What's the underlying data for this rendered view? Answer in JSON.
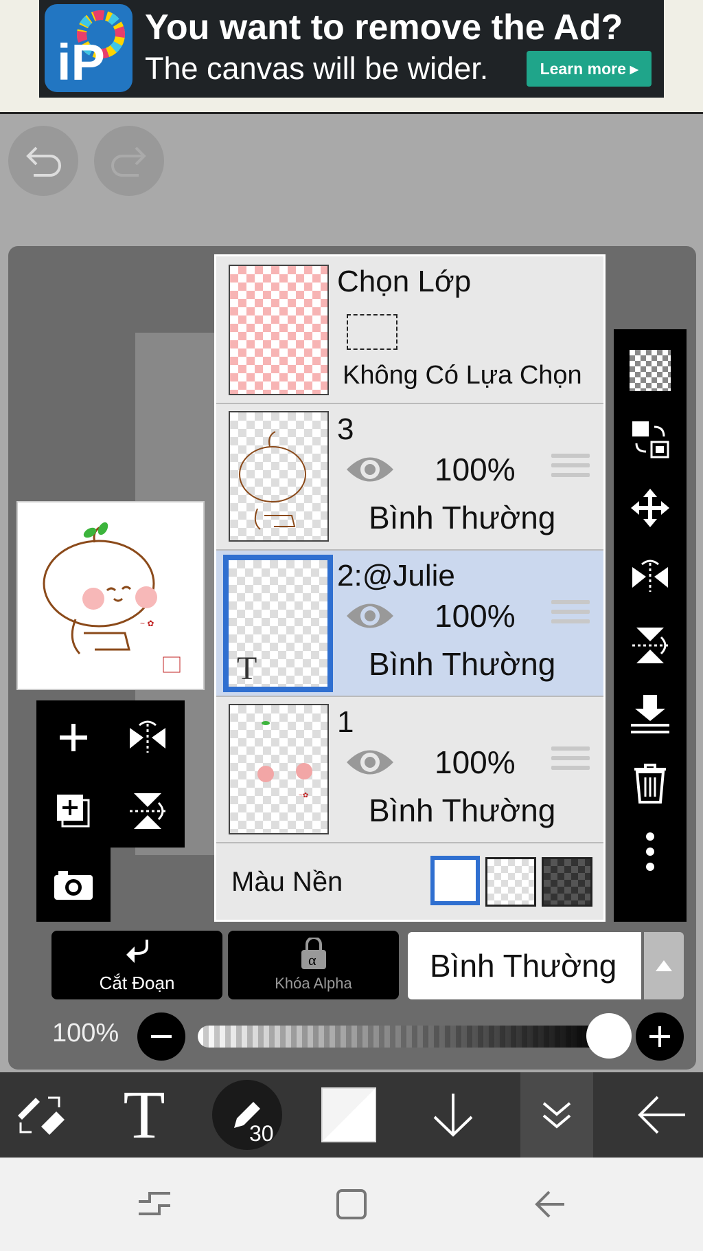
{
  "ad": {
    "title": "You want to remove the Ad?",
    "subtitle": "The canvas will be wider.",
    "button": "Learn more"
  },
  "layers_panel": {
    "selection_layer": {
      "title": "Chọn Lớp",
      "status": "Không Có Lựa Chọn"
    },
    "layers": [
      {
        "name": "3",
        "opacity": "100%",
        "blend": "Bình Thường",
        "visible": true,
        "selected": false
      },
      {
        "name": "2:@Julie",
        "opacity": "100%",
        "blend": "Bình Thường",
        "visible": true,
        "selected": true
      },
      {
        "name": "1",
        "opacity": "100%",
        "blend": "Bình Thường",
        "visible": true,
        "selected": false
      }
    ],
    "background": {
      "label": "Màu Nền",
      "options": [
        "white",
        "transparent",
        "dark-checker"
      ],
      "selected": "white"
    }
  },
  "controls": {
    "clip_label": "Cắt Đoạn",
    "alpha_lock_label": "Khóa Alpha",
    "blend_mode": "Bình Thường",
    "opacity_label": "100%",
    "opacity_value": 1.0
  },
  "bottom_toolbar": {
    "brush_size": "30"
  },
  "colors": {
    "selected_row": "#cbd8ee",
    "selection_border": "#2f6fd0",
    "ad_button": "#1fa58a"
  }
}
